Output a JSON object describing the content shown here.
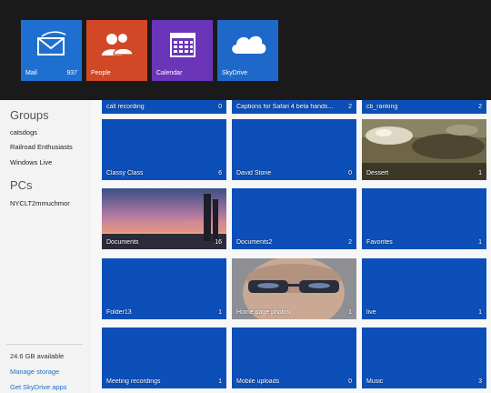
{
  "apps": [
    {
      "label": "Mail",
      "count": "937",
      "icon": "mail-icon",
      "color": "#1f6fd0"
    },
    {
      "label": "People",
      "count": "",
      "icon": "people-icon",
      "color": "#d24726"
    },
    {
      "label": "Calendar",
      "count": "",
      "icon": "calendar-icon",
      "color": "#6a35b8"
    },
    {
      "label": "SkyDrive",
      "count": "",
      "icon": "cloud-icon",
      "color": "#1e68c9"
    }
  ],
  "sidebar": {
    "groups_heading": "Groups",
    "groups": [
      "catsdogs",
      "Railroad Enthusiasts",
      "Windows Live"
    ],
    "pcs_heading": "PCs",
    "pcs": [
      "NYCLT2mmuchmor"
    ],
    "storage": "24.6 GB available",
    "manage_storage": "Manage storage",
    "get_apps": "Get SkyDrive apps"
  },
  "folders": [
    {
      "name": "call recording",
      "count": "0"
    },
    {
      "name": "Captions for Safari 4 beta hands...",
      "count": "2"
    },
    {
      "name": "cb_ranking",
      "count": "2"
    },
    {
      "name": "Classy Class",
      "count": "6"
    },
    {
      "name": "David Stone",
      "count": "0"
    },
    {
      "name": "Dessert",
      "count": "1"
    },
    {
      "name": "Documents",
      "count": "16"
    },
    {
      "name": "Documents2",
      "count": "2"
    },
    {
      "name": "Favorites",
      "count": "1"
    },
    {
      "name": "Folder13",
      "count": "1"
    },
    {
      "name": "Home page photos",
      "count": "1"
    },
    {
      "name": "live",
      "count": "1"
    },
    {
      "name": "Meeting recordings",
      "count": "1"
    },
    {
      "name": "Mobile uploads",
      "count": "0"
    },
    {
      "name": "Music",
      "count": "3"
    }
  ],
  "colors": {
    "tile_blue": "#0d4fb8",
    "link_blue": "#1f6fc9",
    "topbar": "#1a1a1a"
  }
}
